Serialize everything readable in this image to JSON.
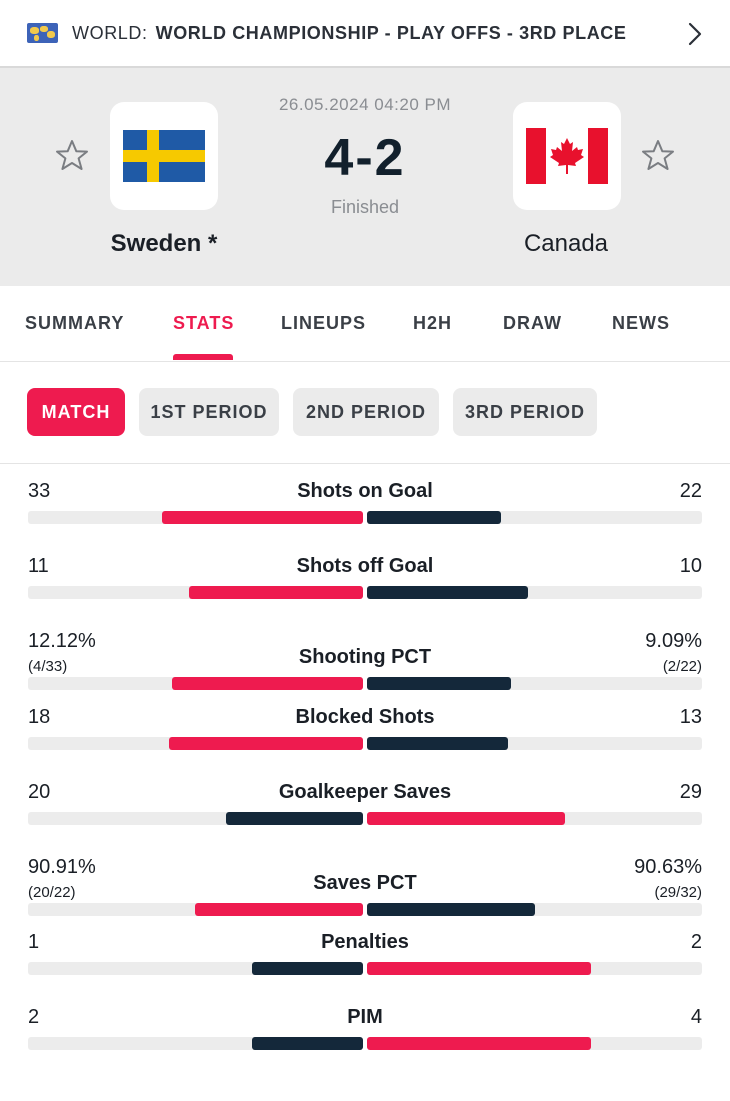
{
  "competition": {
    "prefix": "WORLD:",
    "name": "WORLD CHAMPIONSHIP - PLAY OFFS - 3RD PLACE",
    "icon": "world-map-icon"
  },
  "match": {
    "date": "26.05.2024 04:20 PM",
    "score": "4-2",
    "status": "Finished",
    "home": {
      "name": "Sweden *",
      "flag": "sweden-flag"
    },
    "away": {
      "name": "Canada",
      "flag": "canada-flag"
    }
  },
  "tabs": [
    {
      "label": "SUMMARY",
      "active": false
    },
    {
      "label": "STATS",
      "active": true
    },
    {
      "label": "LINEUPS",
      "active": false
    },
    {
      "label": "H2H",
      "active": false
    },
    {
      "label": "DRAW",
      "active": false
    },
    {
      "label": "NEWS",
      "active": false
    }
  ],
  "periods": [
    {
      "label": "MATCH",
      "active": true
    },
    {
      "label": "1ST PERIOD",
      "active": false
    },
    {
      "label": "2ND PERIOD",
      "active": false
    },
    {
      "label": "3RD PERIOD",
      "active": false
    }
  ],
  "colors": {
    "accent": "#ee1b4f",
    "dark_bar": "#14283a",
    "track": "#ececec"
  },
  "stats": [
    {
      "label": "Shots on Goal",
      "home": "33",
      "away": "22",
      "home_fill": 0.6,
      "away_fill": 0.4,
      "leader": "home"
    },
    {
      "label": "Shots off Goal",
      "home": "11",
      "away": "10",
      "home_fill": 0.52,
      "away_fill": 0.48,
      "leader": "home"
    },
    {
      "label": "Shooting PCT",
      "home": "12.12%",
      "away": "9.09%",
      "home_sub": "(4/33)",
      "away_sub": "(2/22)",
      "home_fill": 0.57,
      "away_fill": 0.43,
      "leader": "home"
    },
    {
      "label": "Blocked Shots",
      "home": "18",
      "away": "13",
      "home_fill": 0.58,
      "away_fill": 0.42,
      "leader": "home"
    },
    {
      "label": "Goalkeeper Saves",
      "home": "20",
      "away": "29",
      "home_fill": 0.41,
      "away_fill": 0.59,
      "leader": "away"
    },
    {
      "label": "Saves PCT",
      "home": "90.91%",
      "away": "90.63%",
      "home_sub": "(20/22)",
      "away_sub": "(29/32)",
      "home_fill": 0.5,
      "away_fill": 0.5,
      "leader": "home"
    },
    {
      "label": "Penalties",
      "home": "1",
      "away": "2",
      "home_fill": 0.33,
      "away_fill": 0.67,
      "leader": "away"
    },
    {
      "label": "PIM",
      "home": "2",
      "away": "4",
      "home_fill": 0.33,
      "away_fill": 0.67,
      "leader": "away"
    }
  ]
}
